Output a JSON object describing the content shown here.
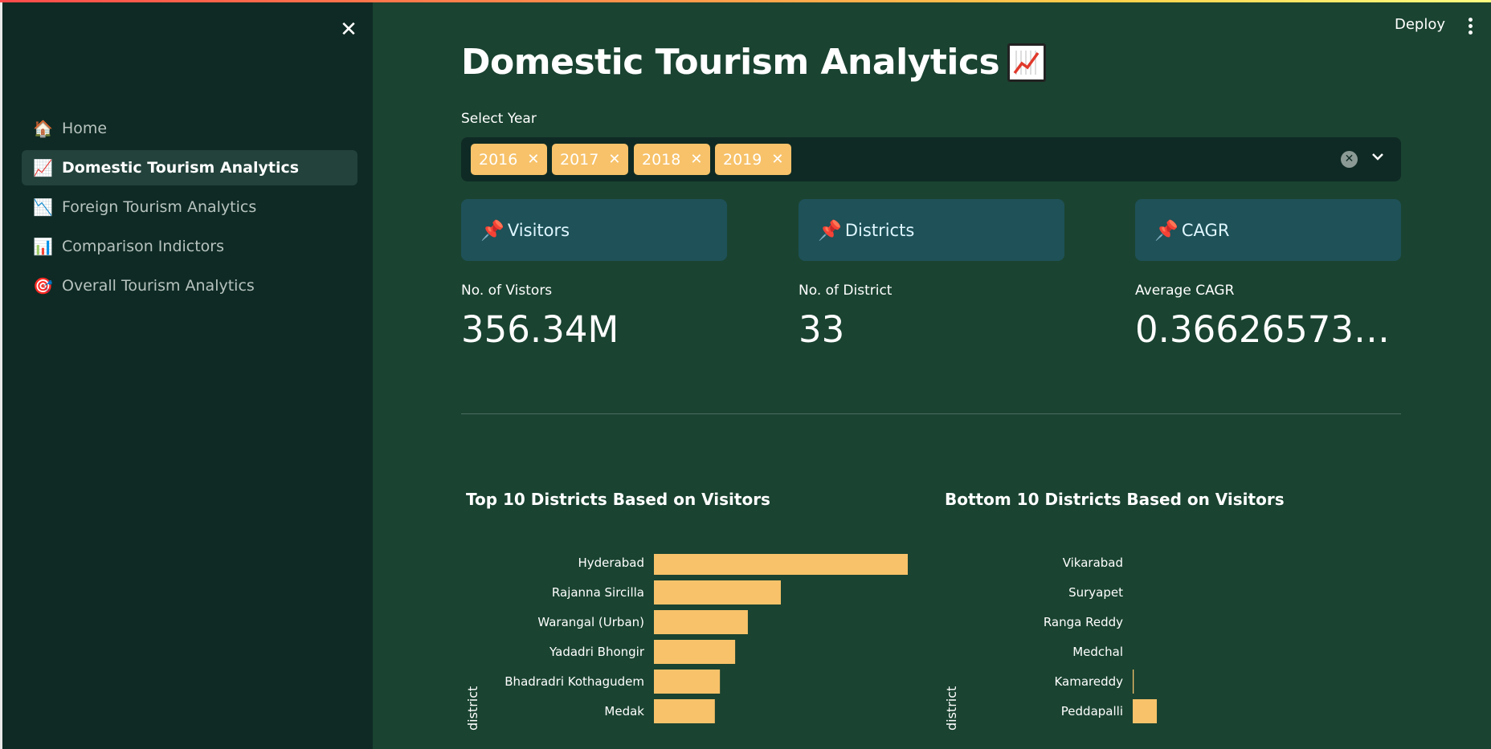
{
  "sidebar": {
    "items": [
      {
        "icon": "🏠",
        "label": "Home",
        "active": false
      },
      {
        "icon": "📈",
        "label": "Domestic Tourism Analytics",
        "active": true
      },
      {
        "icon": "📉",
        "label": "Foreign Tourism Analytics",
        "active": false
      },
      {
        "icon": "📊",
        "label": "Comparison Indictors",
        "active": false
      },
      {
        "icon": "🎯",
        "label": "Overall Tourism Analytics",
        "active": false
      }
    ]
  },
  "header": {
    "deploy_label": "Deploy"
  },
  "page": {
    "title": "Domestic Tourism Analytics",
    "title_icon": "chart-increasing-icon"
  },
  "year_select": {
    "label": "Select Year",
    "selected": [
      "2016",
      "2017",
      "2018",
      "2019"
    ]
  },
  "cards": [
    {
      "icon": "📌",
      "label": "Visitors"
    },
    {
      "icon": "📌",
      "label": "Districts"
    },
    {
      "icon": "📌",
      "label": "CAGR"
    }
  ],
  "metrics": [
    {
      "label": "No. of Vistors",
      "value": "356.34M"
    },
    {
      "label": "No. of District",
      "value": "33"
    },
    {
      "label": "Average CAGR",
      "value": "0.3662657338…"
    }
  ],
  "colors": {
    "accent": "#f7c26a",
    "background": "#1a4331",
    "sidebar": "#0f2a24",
    "card": "#1e5158"
  },
  "chart_data": [
    {
      "type": "bar",
      "orientation": "horizontal",
      "title": "Top 10 Districts Based on Visitors",
      "ylabel": "district",
      "categories": [
        "Hyderabad",
        "Rajanna Sircilla",
        "Warangal (Urban)",
        "Yadadri Bhongir",
        "Bhadradri Kothagudem",
        "Medak"
      ],
      "values": [
        100,
        50,
        37,
        32,
        26,
        24
      ]
    },
    {
      "type": "bar",
      "orientation": "horizontal",
      "title": "Bottom 10 Districts Based on Visitors",
      "ylabel": "district",
      "categories": [
        "Vikarabad",
        "Suryapet",
        "Ranga Reddy",
        "Medchal",
        "Kamareddy",
        "Peddapalli"
      ],
      "values": [
        0,
        0,
        0,
        0,
        0.4,
        9.5
      ]
    }
  ]
}
